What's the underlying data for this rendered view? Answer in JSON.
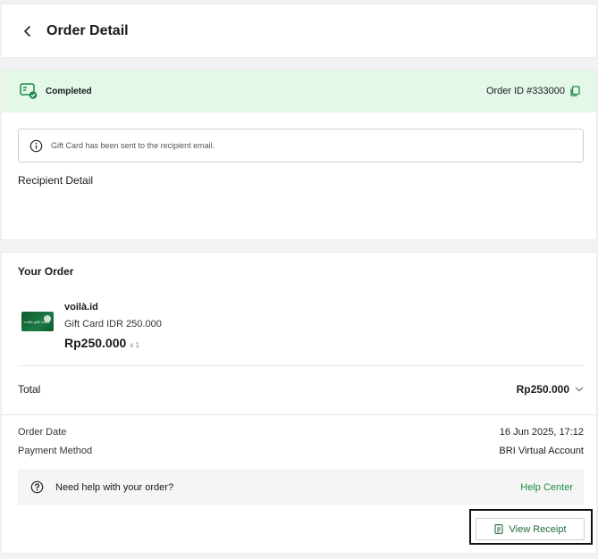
{
  "header": {
    "title": "Order Detail"
  },
  "status": {
    "label": "Completed",
    "order_id": "Order ID #333000"
  },
  "notice": {
    "text": "Gift Card has been sent to the recipient email."
  },
  "recipient": {
    "title": "Recipient Detail"
  },
  "order": {
    "section_title": "Your Order",
    "item": {
      "brand": "voilà.id",
      "name": "Gift Card IDR 250.000",
      "price": "Rp250.000",
      "qty": "x 1",
      "thumb_text": "voilà gift card"
    },
    "total_label": "Total",
    "total_value": "Rp250.000",
    "order_date_label": "Order Date",
    "order_date_value": "16 Jun 2025, 17:12",
    "payment_label": "Payment Method",
    "payment_value": "BRI Virtual Account"
  },
  "help": {
    "text": "Need help with your order?",
    "link": "Help Center"
  },
  "receipt": {
    "label": "View Receipt"
  },
  "colors": {
    "accent_green": "#1f8a47",
    "status_bg": "#e3f8e8"
  }
}
